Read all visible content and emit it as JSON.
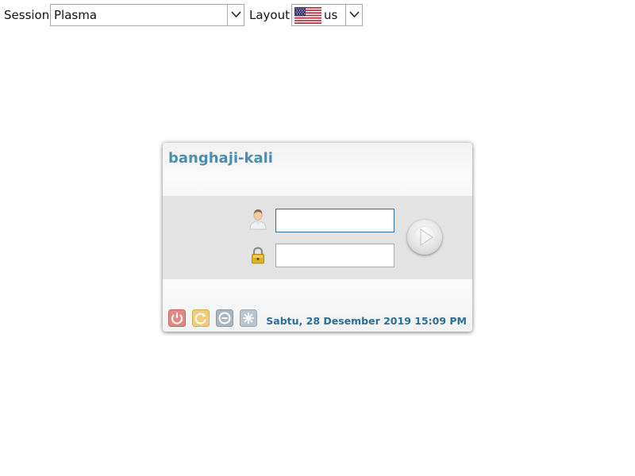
{
  "toolbar": {
    "session_label": "Session",
    "session_value": "Plasma",
    "layout_label": "Layout",
    "layout_value": "us",
    "layout_flag": "us-flag-icon"
  },
  "login": {
    "hostname": "banghaji-kali",
    "username_value": "",
    "password_value": "",
    "datetime": "Sabtu, 28 Desember 2019 15:09 PM"
  },
  "power_buttons": [
    "shutdown-icon",
    "restart-icon",
    "suspend-icon",
    "hibernate-icon"
  ],
  "colors": {
    "hostname": "#4a8fb0",
    "datetime": "#2b6f9a",
    "focus_border": "#2f6ba3"
  }
}
